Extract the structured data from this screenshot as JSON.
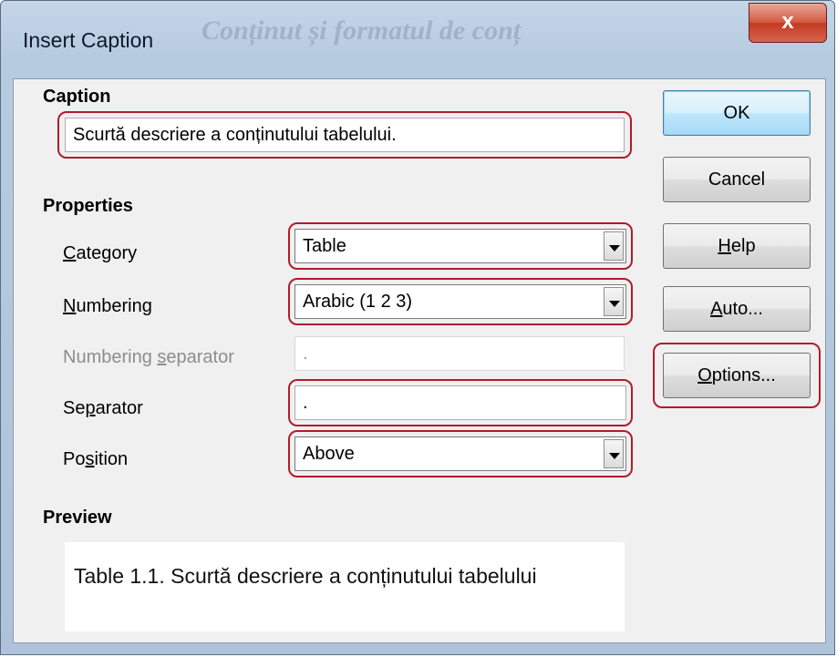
{
  "window": {
    "title": "Insert Caption",
    "title_ghost": "Conținut și formatul de conț",
    "close_glyph": "x"
  },
  "caption": {
    "section_label": "Caption",
    "value": "Scurtă descriere a conținutului tabelului."
  },
  "properties": {
    "section_label": "Properties",
    "category": {
      "label_first": "C",
      "label_rest": "ategory",
      "value": "Table"
    },
    "numbering": {
      "label_first": "N",
      "label_rest": "umbering",
      "value": "Arabic (1 2 3)"
    },
    "numbering_separator": {
      "label_pre": "Numbering ",
      "label_u": "s",
      "label_post": "eparator",
      "value": "."
    },
    "separator": {
      "label_pre": "Se",
      "label_u": "p",
      "label_post": "arator",
      "value": "."
    },
    "position": {
      "label_pre": "Po",
      "label_u": "s",
      "label_post": "ition",
      "value": "Above"
    }
  },
  "preview": {
    "section_label": "Preview",
    "text": "Table 1.1. Scurtă descriere a conținutului tabelului"
  },
  "buttons": {
    "ok": "OK",
    "cancel": "Cancel",
    "help_u": "H",
    "help_rest": "elp",
    "auto_u": "A",
    "auto_rest": "uto...",
    "options_u": "O",
    "options_rest": "ptions..."
  },
  "colors": {
    "highlight": "#b01c2c",
    "titlebar": "#b7cbe0",
    "close_button": "#c13b23",
    "dialog_bg": "#f0f0f0"
  }
}
